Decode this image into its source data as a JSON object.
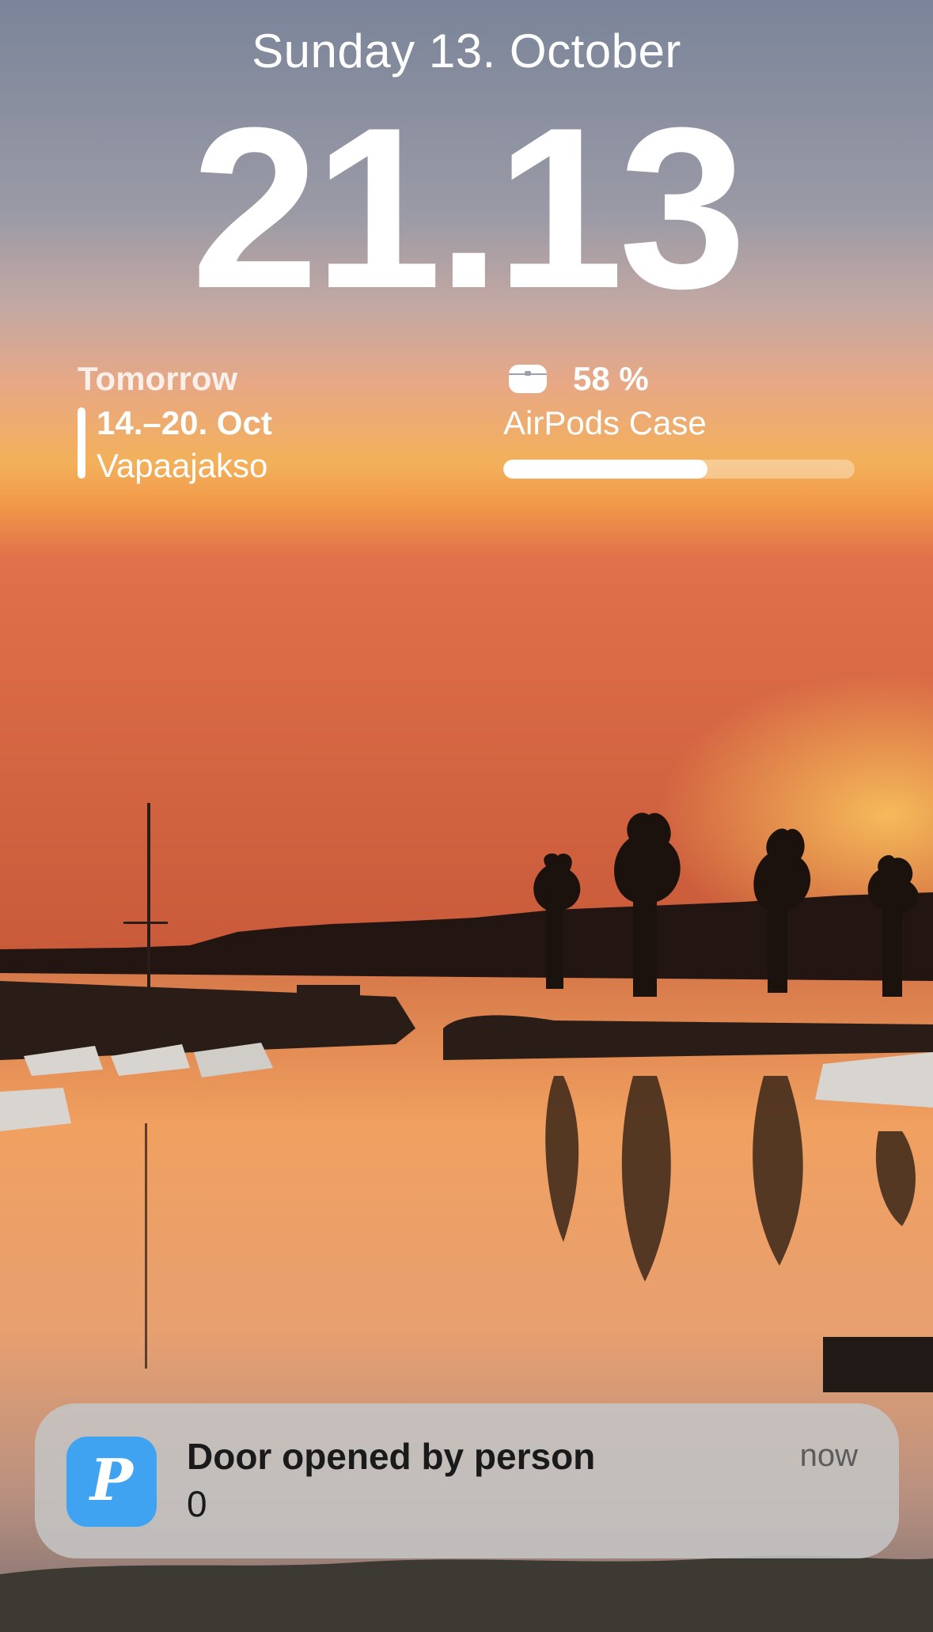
{
  "lock_screen": {
    "date": "Sunday 13. October",
    "time": "21.13"
  },
  "calendar_widget": {
    "title": "Tomorrow",
    "event_dates": "14.–20. Oct",
    "event_name": "Vapaajakso",
    "color": "#ffffff"
  },
  "battery_widget": {
    "icon": "airpods-case-icon",
    "percent_text": "58 %",
    "level_fraction": 0.58,
    "device_name": "AirPods Case"
  },
  "notification": {
    "app_icon": "script-p-app-icon",
    "app_icon_color": "#3fa3f2",
    "title": "Door opened by person",
    "body": "0",
    "timestamp": "now"
  },
  "wallpaper": {
    "sky_top_color": "#7a8499",
    "horizon_color": "#f5a040",
    "water_color": "#e8905a"
  }
}
